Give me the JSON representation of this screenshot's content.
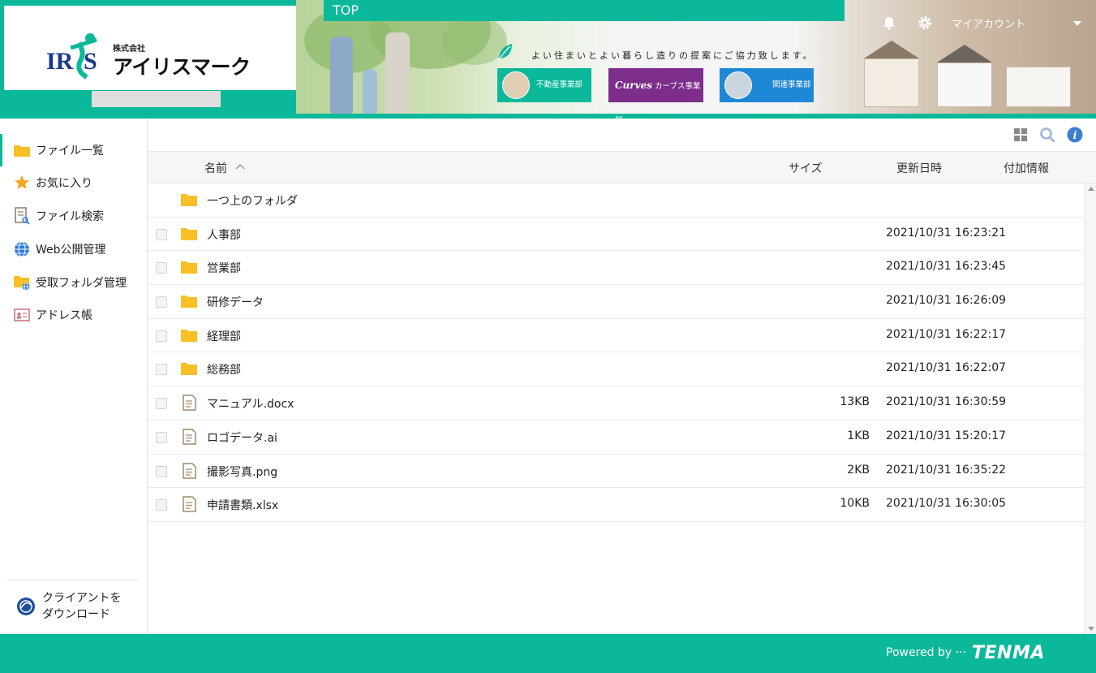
{
  "header": {
    "company_small": "株式会社",
    "company_name": "アイリスマーク",
    "top_label": "TOP",
    "tagline": "よい住まいとよい暮らし造りの提案にご協力致します。",
    "biz_buttons": [
      "不動産事業部",
      "カーブス事業部",
      "関連事業部"
    ],
    "curves_logo": "Curves",
    "account_label": "マイアカウント"
  },
  "sidebar": {
    "items": [
      {
        "label": "ファイル一覧",
        "icon": "folder-icon",
        "active": true
      },
      {
        "label": "お気に入り",
        "icon": "star-icon"
      },
      {
        "label": "ファイル検索",
        "icon": "file-search-icon"
      },
      {
        "label": "Web公開管理",
        "icon": "globe-icon"
      },
      {
        "label": "受取フォルダ管理",
        "icon": "receive-folder-icon"
      },
      {
        "label": "アドレス帳",
        "icon": "address-book-icon"
      }
    ],
    "client_download": [
      "クライアントを",
      "ダウンロード"
    ]
  },
  "list": {
    "columns": {
      "name": "名前",
      "size": "サイズ",
      "date": "更新日時",
      "extra": "付加情報"
    },
    "parent_folder": "一つ上のフォルダ",
    "rows": [
      {
        "type": "folder",
        "name": "人事部",
        "size": "",
        "date": "2021/10/31 16:23:21"
      },
      {
        "type": "folder",
        "name": "営業部",
        "size": "",
        "date": "2021/10/31 16:23:45"
      },
      {
        "type": "folder",
        "name": "研修データ",
        "size": "",
        "date": "2021/10/31 16:26:09"
      },
      {
        "type": "folder",
        "name": "経理部",
        "size": "",
        "date": "2021/10/31 16:22:17"
      },
      {
        "type": "folder",
        "name": "総務部",
        "size": "",
        "date": "2021/10/31 16:22:07"
      },
      {
        "type": "file",
        "name": "マニュアル.docx",
        "size": "13KB",
        "date": "2021/10/31 16:30:59"
      },
      {
        "type": "file",
        "name": "ロゴデータ.ai",
        "size": "1KB",
        "date": "2021/10/31 15:20:17"
      },
      {
        "type": "file",
        "name": "撮影写真.png",
        "size": "2KB",
        "date": "2021/10/31 16:35:22"
      },
      {
        "type": "file",
        "name": "申請書類.xlsx",
        "size": "10KB",
        "date": "2021/10/31 16:30:05"
      }
    ]
  },
  "footer": {
    "powered": "Powered by ···",
    "brand": "TENMA"
  },
  "colors": {
    "accent": "#0bb89a",
    "folder": "#f9bf25",
    "curves": "#7c2e8a",
    "related": "#1e88d6"
  }
}
